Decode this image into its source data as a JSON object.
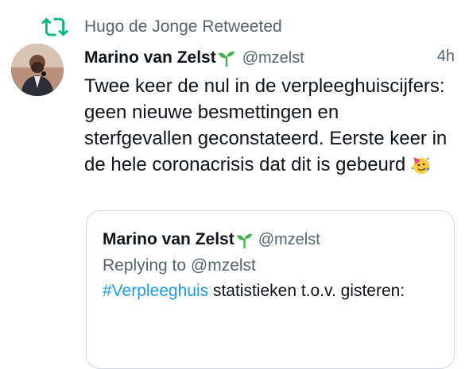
{
  "retweet": {
    "label": "Hugo de Jonge Retweeted",
    "icon": "retweet-icon"
  },
  "tweet": {
    "author_name": "Marino van Zelst",
    "author_handle": "@mzelst",
    "time": "4h",
    "text": "Twee keer de nul in de verpleeghuiscijfers: geen nieuwe besmettingen en sterfgevallen geconstateerd. Eerste keer in de hele coronacrisis dat dit is gebeurd",
    "emoji": "party-face-emoji"
  },
  "quote": {
    "author_name": "Marino van Zelst",
    "author_handle": "@mzelst",
    "replying_to": "Replying to @mzelst",
    "hashtag": "#Verpleeghuis",
    "text_rest": " statistieken t.o.v. gisteren:"
  },
  "colors": {
    "accent": "#1d9bf0",
    "retweet_green": "#00ba7c",
    "muted": "#536471",
    "sprout": "#3bb54a"
  }
}
